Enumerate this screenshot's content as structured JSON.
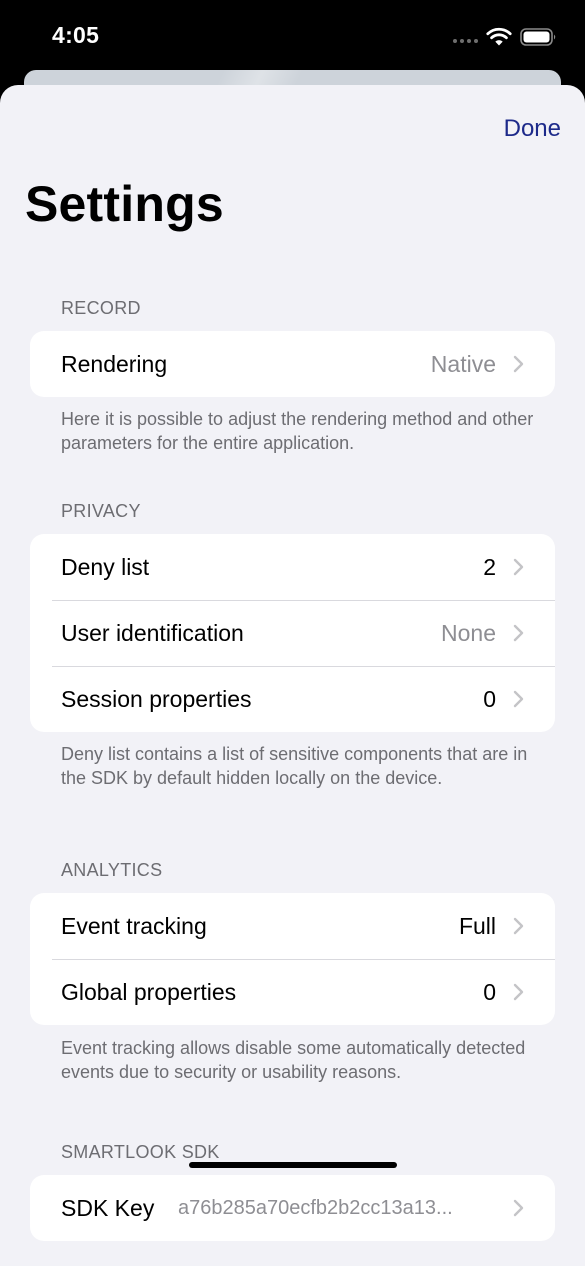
{
  "status_bar": {
    "time": "4:05"
  },
  "nav": {
    "done_label": "Done"
  },
  "page": {
    "title": "Settings"
  },
  "sections": {
    "record": {
      "header": "RECORD",
      "footer": "Here it is possible to adjust the rendering method and other parameters for the entire application.",
      "rows": [
        {
          "label": "Rendering",
          "value": "Native"
        }
      ]
    },
    "privacy": {
      "header": "PRIVACY",
      "footer": "Deny list contains a list of sensitive components that are in the SDK by default hidden locally on the device.",
      "rows": [
        {
          "label": "Deny list",
          "value": "2"
        },
        {
          "label": "User identification",
          "value": "None"
        },
        {
          "label": "Session properties",
          "value": "0"
        }
      ]
    },
    "analytics": {
      "header": "ANALYTICS",
      "footer": "Event tracking allows disable some automatically detected events due to security or usability reasons.",
      "rows": [
        {
          "label": "Event tracking",
          "value": "Full"
        },
        {
          "label": "Global properties",
          "value": "0"
        }
      ]
    },
    "sdk": {
      "header": "SMARTLOOK SDK",
      "rows": [
        {
          "label": "SDK Key",
          "value": "a76b285a70ecfb2b2cc13a13..."
        }
      ]
    }
  },
  "colors": {
    "accent": "#1d2a8a",
    "background": "#f2f2f7",
    "secondary_text": "#8e8e93",
    "chevron": "#c4c4c7"
  },
  "icons": [
    "wifi-icon",
    "battery-icon",
    "chevron-right-icon"
  ]
}
